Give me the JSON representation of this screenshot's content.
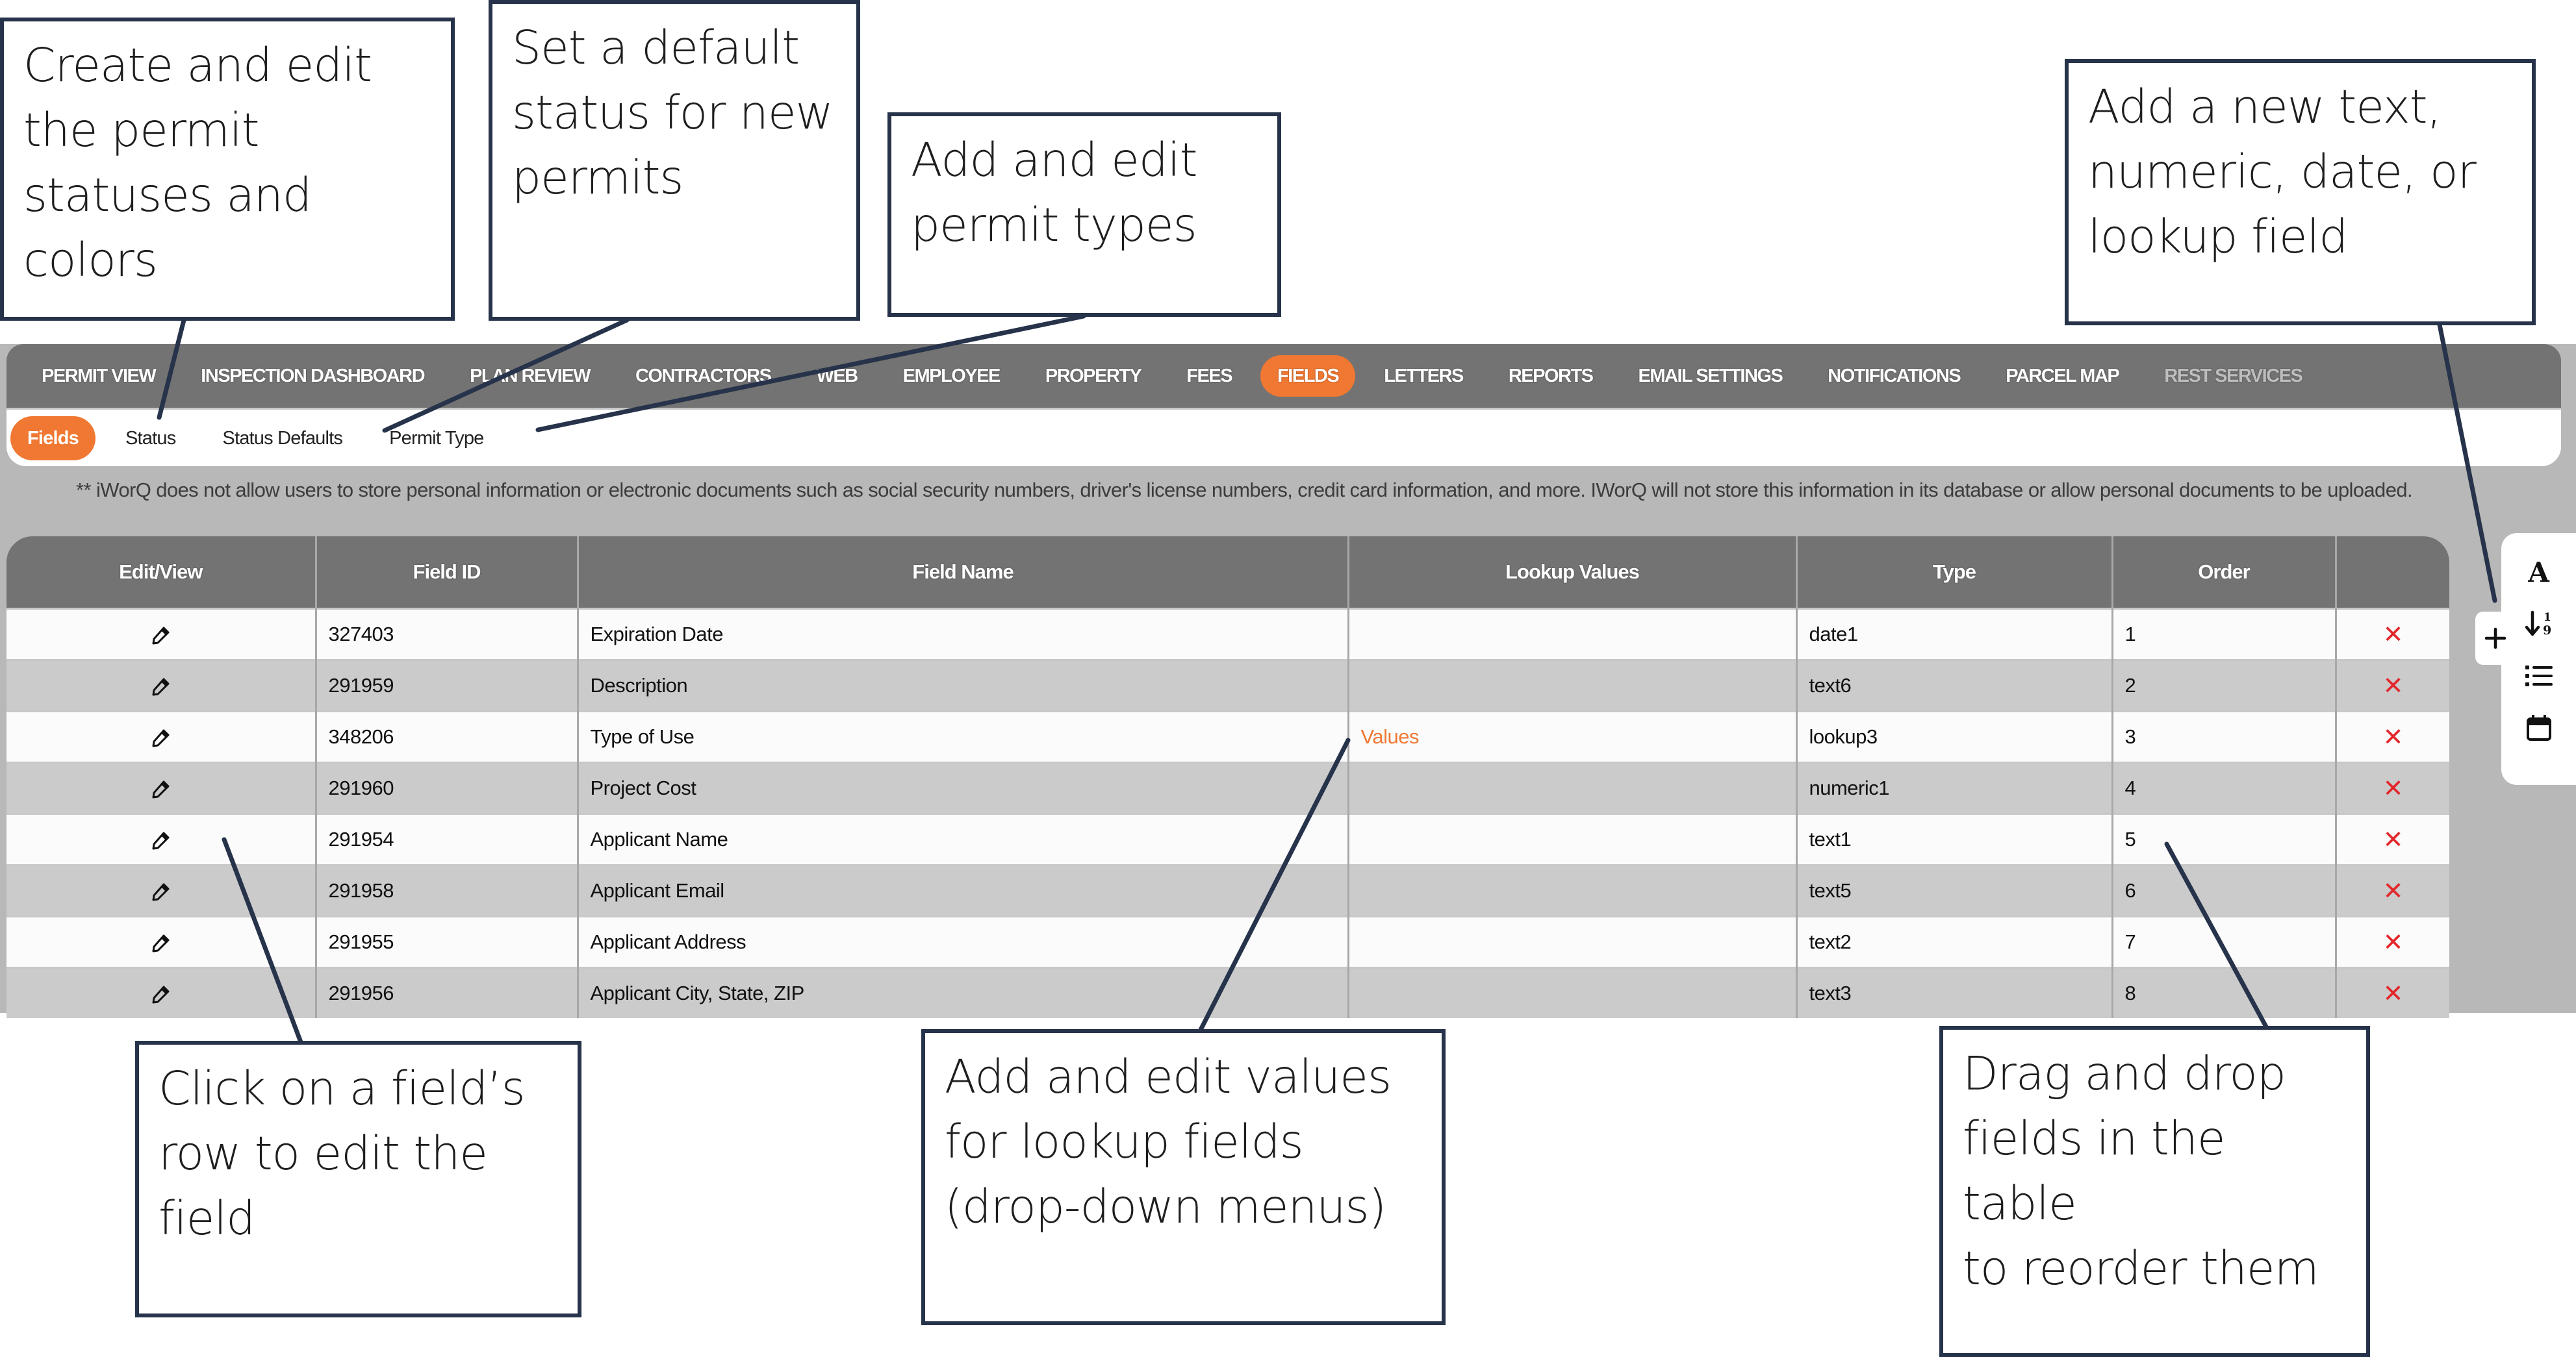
{
  "top_nav": {
    "items": [
      {
        "label": "PERMIT VIEW",
        "state": "normal"
      },
      {
        "label": "INSPECTION DASHBOARD",
        "state": "normal"
      },
      {
        "label": "PLAN REVIEW",
        "state": "normal"
      },
      {
        "label": "CONTRACTORS",
        "state": "normal"
      },
      {
        "label": "WEB",
        "state": "normal"
      },
      {
        "label": "EMPLOYEE",
        "state": "normal"
      },
      {
        "label": "PROPERTY",
        "state": "normal"
      },
      {
        "label": "FEES",
        "state": "normal"
      },
      {
        "label": "FIELDS",
        "state": "active"
      },
      {
        "label": "LETTERS",
        "state": "normal"
      },
      {
        "label": "REPORTS",
        "state": "normal"
      },
      {
        "label": "EMAIL SETTINGS",
        "state": "normal"
      },
      {
        "label": "NOTIFICATIONS",
        "state": "normal"
      },
      {
        "label": "PARCEL MAP",
        "state": "normal"
      },
      {
        "label": "REST SERVICES",
        "state": "disabled"
      }
    ]
  },
  "sub_nav": {
    "items": [
      {
        "label": "Fields",
        "state": "active"
      },
      {
        "label": "Status",
        "state": "normal"
      },
      {
        "label": "Status Defaults",
        "state": "normal"
      },
      {
        "label": "Permit Type",
        "state": "normal"
      }
    ]
  },
  "notice": "** iWorQ does not allow users to store personal information or electronic documents such as social security numbers, driver's license numbers, credit card information, and more. IWorQ will not store this information in its database or allow personal documents to be uploaded.",
  "table": {
    "columns": [
      "Edit/View",
      "Field ID",
      "Field Name",
      "Lookup Values",
      "Type",
      "Order",
      ""
    ],
    "rows": [
      {
        "field_id": "327403",
        "field_name": "Expiration Date",
        "lookup_values": "",
        "type": "date1",
        "order": "1"
      },
      {
        "field_id": "291959",
        "field_name": "Description",
        "lookup_values": "",
        "type": "text6",
        "order": "2"
      },
      {
        "field_id": "348206",
        "field_name": "Type of Use",
        "lookup_values": "Values",
        "type": "lookup3",
        "order": "3"
      },
      {
        "field_id": "291960",
        "field_name": "Project Cost",
        "lookup_values": "",
        "type": "numeric1",
        "order": "4"
      },
      {
        "field_id": "291954",
        "field_name": "Applicant Name",
        "lookup_values": "",
        "type": "text1",
        "order": "5"
      },
      {
        "field_id": "291958",
        "field_name": "Applicant Email",
        "lookup_values": "",
        "type": "text5",
        "order": "6"
      },
      {
        "field_id": "291955",
        "field_name": "Applicant Address",
        "lookup_values": "",
        "type": "text2",
        "order": "7"
      },
      {
        "field_id": "291956",
        "field_name": "Applicant City, State, ZIP",
        "lookup_values": "",
        "type": "text3",
        "order": "8"
      }
    ],
    "edit_icon": "pencil-icon",
    "delete_icon": "close-x-icon",
    "delete_glyph": "✕"
  },
  "side_toolbar": {
    "add_button_glyph": "+",
    "tools": [
      {
        "name": "text-field-icon",
        "glyph": "A"
      },
      {
        "name": "numeric-field-icon",
        "glyph": "↓19"
      },
      {
        "name": "lookup-field-icon",
        "glyph": "list"
      },
      {
        "name": "date-field-icon",
        "glyph": "calendar"
      }
    ]
  },
  "callouts": {
    "statuses": "Create and edit\nthe permit\nstatuses and\ncolors",
    "status_defaults": "Set a default\nstatus for new\npermits",
    "permit_types": "Add and edit\npermit types",
    "add_field": "Add a new text,\nnumeric, date, or\nlookup field",
    "edit_row": "Click on a field’s\nrow to edit the\nfield",
    "lookup_values": "Add and edit values\nfor lookup fields\n(drop-down menus)",
    "reorder": "Drag and drop\nfields in the table\nto reorder them"
  },
  "colors": {
    "accent_orange": "#f07832",
    "nav_gray": "#737373",
    "panel_gray": "#b8b8b8",
    "delete_red": "#e3262b",
    "callout_border": "#26334a"
  }
}
